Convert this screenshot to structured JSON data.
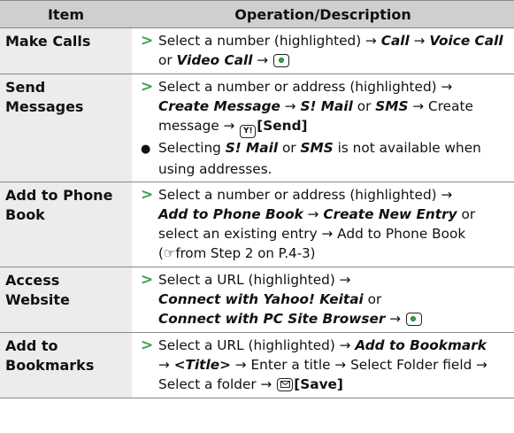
{
  "header": {
    "item": "Item",
    "description": "Operation/Description"
  },
  "rows": [
    {
      "item": "Make Calls",
      "l1": "Select a number (highlighted) → ",
      "l1_b1": "Call",
      "l1_t2": " → ",
      "l1_b2": "Voice Call",
      "l2_t1": "or ",
      "l2_b1": "Video Call",
      "l2_t2": " → "
    },
    {
      "item": "Send Messages",
      "l1": "Select a number or address (highlighted) →",
      "l2_b1": "Create Message",
      "l2_t1": " → ",
      "l2_b2": "S! Mail",
      "l2_t2": " or ",
      "l2_b3": "SMS",
      "l2_t3": " → Create",
      "l3_t1": "message → ",
      "l3_key": "Y!",
      "l3_b1": "[Send]",
      "n_t1": "Selecting ",
      "n_b1": "S! Mail",
      "n_t2": " or ",
      "n_b2": "SMS",
      "n_t3": " is not available when",
      "n2": "using addresses."
    },
    {
      "item": "Add to Phone Book",
      "l1": "Select a number or address (highlighted) →",
      "l2_b1": "Add to Phone Book",
      "l2_t1": " → ",
      "l2_b2": "Create New Entry",
      "l2_t2": " or",
      "l3": "select an existing entry → Add to Phone Book",
      "l4_t1": "(",
      "l4_icon": "☞",
      "l4_t2": "from Step 2 on P.4-3)"
    },
    {
      "item": "Access Website",
      "l1": "Select a URL (highlighted) →",
      "l2": "Connect with Yahoo! Keitai",
      "l2_t": " or",
      "l3": "Connect with PC Site Browser",
      "l3_t": " → "
    },
    {
      "item": "Add to Bookmarks",
      "l1_t1": "Select a URL (highlighted) → ",
      "l1_b1": "Add to Bookmark",
      "l2_t1": "→ ",
      "l2_b1": "<Title>",
      "l2_t2": " → Enter a title → Select Folder field →",
      "l3_t1": "Select a folder → ",
      "l3_b1": "[Save]"
    }
  ],
  "icons": {
    "step_marker": "green-chevron-icon",
    "center_key": "center-key-icon",
    "yahoo_key": "yahoo-key-icon",
    "mail_key": "mail-key-icon",
    "reference": "pointing-hand-icon",
    "bullet": "bullet-icon"
  },
  "colors": {
    "accent": "#3aa24a",
    "header_bg": "#cfcfcf",
    "item_bg": "#ececec",
    "rule": "#888888"
  }
}
